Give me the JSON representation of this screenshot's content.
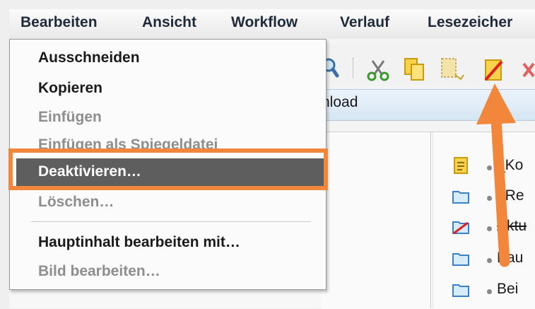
{
  "menubar": {
    "items": [
      "Bearbeiten",
      "Ansicht",
      "Workflow",
      "Verlauf",
      "Lesezeicher"
    ]
  },
  "context_menu": {
    "items": [
      {
        "label": "Ausschneiden",
        "enabled": true
      },
      {
        "label": "Kopieren",
        "enabled": true
      },
      {
        "label": "Einfügen",
        "enabled": false
      },
      {
        "label": "Einfügen als Spiegeldatei",
        "enabled": false
      },
      {
        "label": "Deaktivieren…",
        "enabled": true,
        "highlighted": true
      },
      {
        "label": "Löschen…",
        "enabled": false
      },
      {
        "label": "Hauptinhalt bearbeiten mit…",
        "enabled": true
      },
      {
        "label": "Bild bearbeiten…",
        "enabled": false
      }
    ]
  },
  "toolbar": {
    "icons": [
      "search-icon",
      "cut-icon",
      "copy-icon",
      "paste-icon",
      "deactivate-icon",
      "delete-icon"
    ]
  },
  "address": {
    "text": "nload"
  },
  "file_list": [
    {
      "icon": "page-icon",
      "label": "_Ko"
    },
    {
      "icon": "folder-icon",
      "label": "_Re"
    },
    {
      "icon": "deactivated-folder-icon",
      "label": "Aktu"
    },
    {
      "icon": "folder-icon",
      "label": "Bau"
    },
    {
      "icon": "folder-icon",
      "label": "Bei"
    }
  ],
  "colors": {
    "callout": "#f2863a",
    "highlight": "#5e5e5e",
    "disabled_text": "#8e8e8e"
  }
}
